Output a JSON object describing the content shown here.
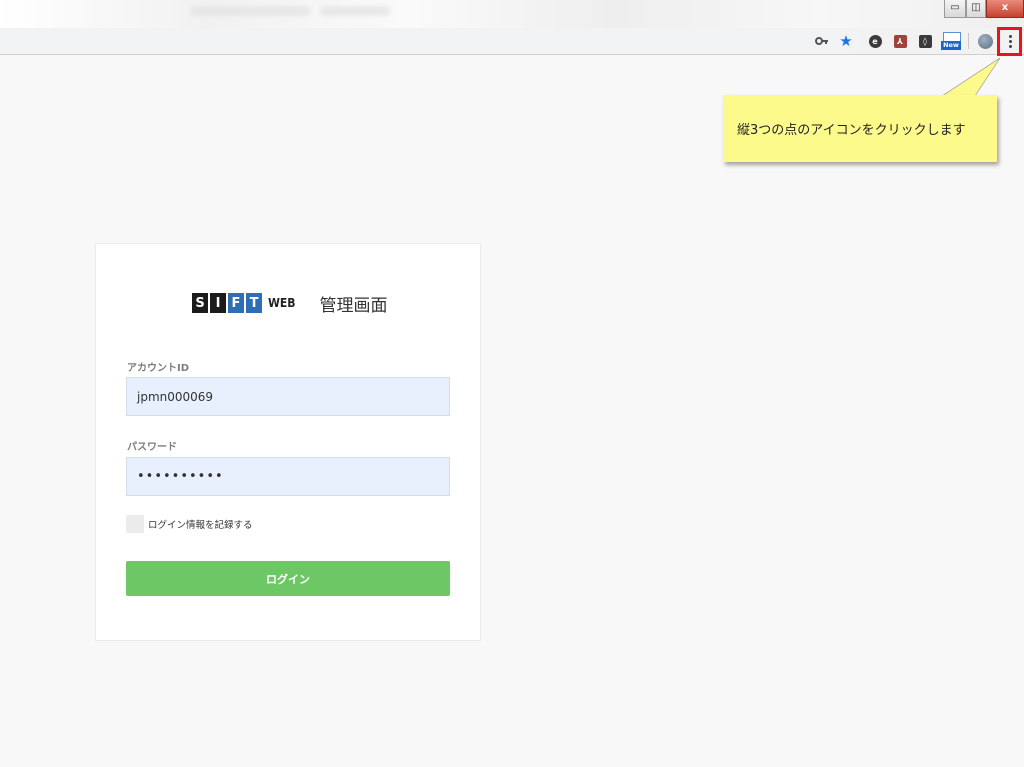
{
  "browser": {
    "window_controls": {
      "minimize": "▭",
      "maximize": "◫",
      "close": "x"
    },
    "toolbar_icons": [
      "key-icon",
      "star-icon",
      "extension-e-icon",
      "pdf-icon",
      "extension-shield-icon",
      "new-extension-icon",
      "profile-avatar-icon",
      "menu-dots-icon"
    ],
    "new_badge": "New"
  },
  "callout": {
    "text": "縦3つの点のアイコンをクリックします"
  },
  "login": {
    "logo_letters": [
      "S",
      "I",
      "F",
      "T"
    ],
    "logo_web": "WEB",
    "admin_title": "管理画面",
    "account_label": "アカウントID",
    "account_value": "jpmn000069",
    "password_label": "パスワード",
    "password_value": "••••••••••",
    "remember_label": "ログイン情報を記録する",
    "login_button": "ログイン"
  },
  "colors": {
    "accent_green": "#6ec765",
    "highlight_red": "#e8141c",
    "callout_yellow": "#fdfa8c",
    "logo_dark": "#1b1b1b",
    "logo_blue": "#2f6db5",
    "input_bg": "#e8f0fe"
  }
}
